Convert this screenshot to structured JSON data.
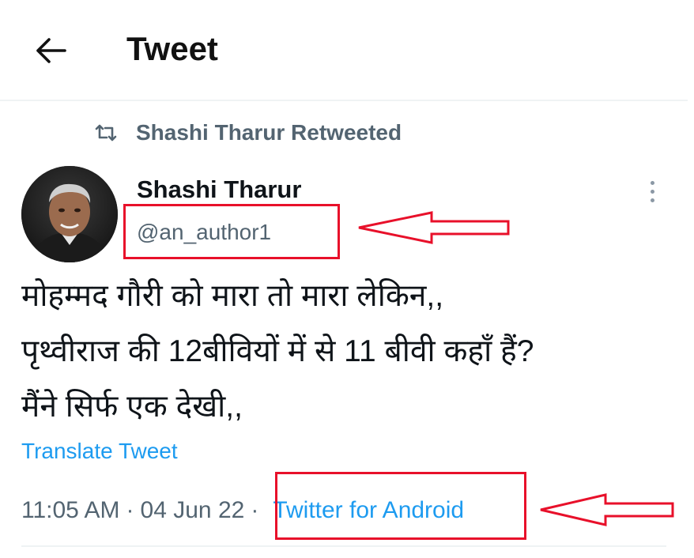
{
  "header": {
    "title": "Tweet",
    "back_icon": "arrow-left-icon"
  },
  "retweet": {
    "icon": "retweet-icon",
    "text": "Shashi Tharur Retweeted"
  },
  "author": {
    "display_name": "Shashi Tharur",
    "handle": "@an_author1",
    "avatar": "avatar"
  },
  "tweet": {
    "lines": [
      "मोहम्मद गौरी को मारा तो मारा लेकिन,,",
      "पृथ्वीराज की 12बीवियों में से 11 बीवी कहाँ हैं?",
      "मैंने सिर्फ एक देखी,,"
    ],
    "translate_label": "Translate Tweet",
    "time": "11:05 AM",
    "separator": "·",
    "date": "04 Jun 22",
    "source": "Twitter for Android"
  },
  "annotations": {
    "highlight_color": "#e8102a",
    "link_color": "#1d9bf0",
    "muted_color": "#536471"
  }
}
